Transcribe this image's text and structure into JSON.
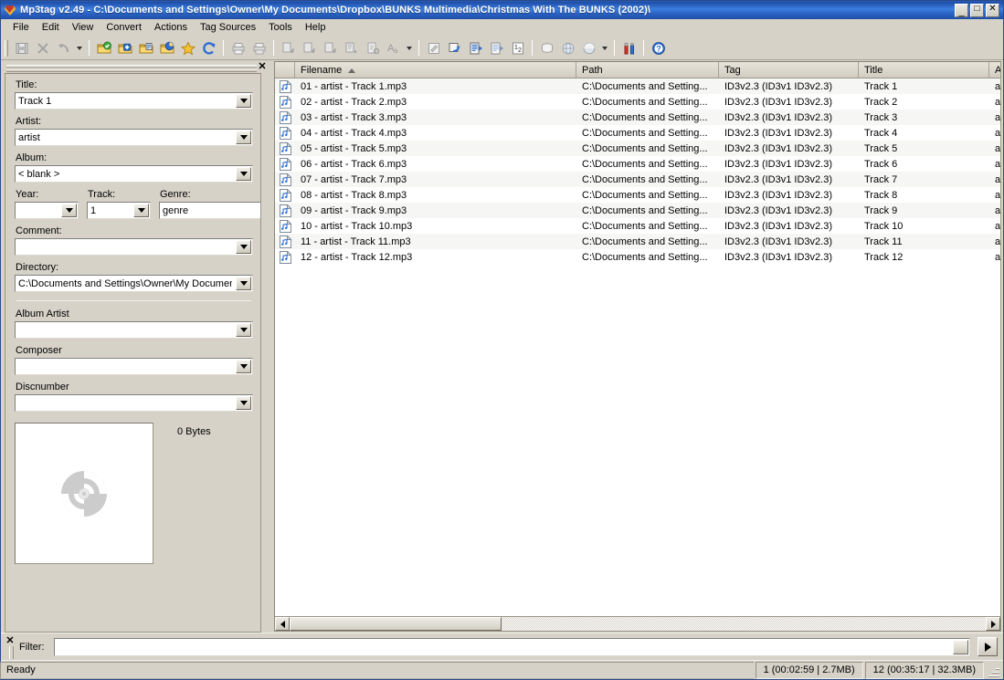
{
  "window": {
    "app_title": "Mp3tag v2.49",
    "separator": "-",
    "path": "C:\\Documents and Settings\\Owner\\My Documents\\Dropbox\\BUNKS Multimedia\\Christmas With The BUNKS (2002)\\",
    "full_title": "Mp3tag v2.49  -  C:\\Documents and Settings\\Owner\\My Documents\\Dropbox\\BUNKS Multimedia\\Christmas With The BUNKS (2002)\\",
    "minimize_label": "_",
    "maximize_label": "□",
    "close_label": "✕",
    "titlebar_color": "#2b63c4"
  },
  "menu": {
    "items": [
      {
        "label": "File"
      },
      {
        "label": "Edit"
      },
      {
        "label": "View"
      },
      {
        "label": "Convert"
      },
      {
        "label": "Actions"
      },
      {
        "label": "Tag Sources"
      },
      {
        "label": "Tools"
      },
      {
        "label": "Help"
      }
    ]
  },
  "toolbar": {
    "buttons": [
      {
        "name": "save-icon",
        "label": "Save",
        "enabled": false
      },
      {
        "name": "remove-tag-icon",
        "label": "Remove tag",
        "enabled": false
      },
      {
        "name": "undo-icon",
        "label": "Undo",
        "enabled": false
      },
      {
        "name": "undo-dropdown-icon",
        "label": "Undo history",
        "enabled": false
      },
      {
        "name": "change-directory-icon",
        "label": "Change directory",
        "enabled": true
      },
      {
        "name": "add-directory-icon",
        "label": "Add directory",
        "enabled": true
      },
      {
        "name": "add-files-icon",
        "label": "Add files",
        "enabled": true
      },
      {
        "name": "open-playlist-icon",
        "label": "Open playlist",
        "enabled": true
      },
      {
        "name": "favorites-icon",
        "label": "Favorites",
        "enabled": true
      },
      {
        "name": "refresh-icon",
        "label": "Refresh",
        "enabled": true
      },
      {
        "name": "print-icon",
        "label": "Print",
        "enabled": false
      },
      {
        "name": "print-cover-icon",
        "label": "Print cover",
        "enabled": false
      },
      {
        "name": "tag-to-filename-icon",
        "label": "Tag - Filename",
        "enabled": false
      },
      {
        "name": "filename-to-tag-icon",
        "label": "Filename - Tag",
        "enabled": false
      },
      {
        "name": "filename-to-filename-icon",
        "label": "Filename - Filename",
        "enabled": false
      },
      {
        "name": "tag-to-tag-icon",
        "label": "Tag - Tag",
        "enabled": false
      },
      {
        "name": "text-file-to-tag-icon",
        "label": "Text file - Tag",
        "enabled": false
      },
      {
        "name": "case-conversion-icon",
        "label": "Case conversion",
        "enabled": false
      },
      {
        "name": "convert-dropdown-icon",
        "label": "More conversions",
        "enabled": false
      },
      {
        "name": "edit-actions-icon",
        "label": "Actions",
        "enabled": false
      },
      {
        "name": "quick-actions-icon",
        "label": "Actions (quick)",
        "enabled": true
      },
      {
        "name": "create-playlist-icon",
        "label": "Create playlist",
        "enabled": true
      },
      {
        "name": "playlist-options-icon",
        "label": "Playlist options",
        "enabled": true
      },
      {
        "name": "auto-numbering-icon",
        "label": "Auto-numbering wizard",
        "enabled": true
      },
      {
        "name": "local-tag-source-icon",
        "label": "Tag sources (local)",
        "enabled": false
      },
      {
        "name": "web-tag-source-icon",
        "label": "Tag sources (web)",
        "enabled": false
      },
      {
        "name": "freedb-icon",
        "label": "freedb",
        "enabled": false
      },
      {
        "name": "tag-source-dropdown-icon",
        "label": "Tag source list",
        "enabled": false
      },
      {
        "name": "options-icon",
        "label": "Options",
        "enabled": true
      },
      {
        "name": "help-icon",
        "label": "Help",
        "enabled": true
      }
    ]
  },
  "tag_panel": {
    "close_label": "✕",
    "fields": [
      {
        "name": "title",
        "label": "Title:",
        "value": "Track 1",
        "placeholder": ""
      },
      {
        "name": "artist",
        "label": "Artist:",
        "value": "artist",
        "placeholder": ""
      },
      {
        "name": "album",
        "label": "Album:",
        "value": "< blank >",
        "placeholder": ""
      }
    ],
    "year": {
      "label": "Year:",
      "value": ""
    },
    "track": {
      "label": "Track:",
      "value": "1"
    },
    "genre": {
      "label": "Genre:",
      "value": "genre"
    },
    "comment": {
      "label": "Comment:",
      "value": ""
    },
    "directory": {
      "label": "Directory:",
      "value": "C:\\Documents and Settings\\Owner\\My Documents\\"
    },
    "extra_fields": [
      {
        "name": "albumartist",
        "label": "Album Artist",
        "value": ""
      },
      {
        "name": "composer",
        "label": "Composer",
        "value": ""
      },
      {
        "name": "discnumber",
        "label": "Discnumber",
        "value": ""
      }
    ],
    "cover": {
      "size_label": "0 Bytes",
      "placeholder_icon": "disc-icon"
    }
  },
  "file_list": {
    "columns": [
      {
        "key": "filename",
        "label": "Filename",
        "sorted": "asc"
      },
      {
        "key": "path",
        "label": "Path",
        "sorted": ""
      },
      {
        "key": "tag",
        "label": "Tag",
        "sorted": ""
      },
      {
        "key": "title",
        "label": "Title",
        "sorted": ""
      },
      {
        "key": "artist",
        "label": "A",
        "sorted": ""
      }
    ],
    "rows": [
      {
        "filename": "01 - artist - Track 1.mp3",
        "path": "C:\\Documents and Setting...",
        "tag": "ID3v2.3 (ID3v1 ID3v2.3)",
        "title": "Track 1",
        "artist": "ar"
      },
      {
        "filename": "02 - artist - Track 2.mp3",
        "path": "C:\\Documents and Setting...",
        "tag": "ID3v2.3 (ID3v1 ID3v2.3)",
        "title": "Track 2",
        "artist": "ar"
      },
      {
        "filename": "03 - artist - Track 3.mp3",
        "path": "C:\\Documents and Setting...",
        "tag": "ID3v2.3 (ID3v1 ID3v2.3)",
        "title": "Track 3",
        "artist": "ar"
      },
      {
        "filename": "04 - artist - Track 4.mp3",
        "path": "C:\\Documents and Setting...",
        "tag": "ID3v2.3 (ID3v1 ID3v2.3)",
        "title": "Track 4",
        "artist": "ar"
      },
      {
        "filename": "05 - artist - Track 5.mp3",
        "path": "C:\\Documents and Setting...",
        "tag": "ID3v2.3 (ID3v1 ID3v2.3)",
        "title": "Track 5",
        "artist": "ar"
      },
      {
        "filename": "06 - artist - Track 6.mp3",
        "path": "C:\\Documents and Setting...",
        "tag": "ID3v2.3 (ID3v1 ID3v2.3)",
        "title": "Track 6",
        "artist": "ar"
      },
      {
        "filename": "07 - artist - Track 7.mp3",
        "path": "C:\\Documents and Setting...",
        "tag": "ID3v2.3 (ID3v1 ID3v2.3)",
        "title": "Track 7",
        "artist": "ar"
      },
      {
        "filename": "08 - artist - Track 8.mp3",
        "path": "C:\\Documents and Setting...",
        "tag": "ID3v2.3 (ID3v1 ID3v2.3)",
        "title": "Track 8",
        "artist": "ar"
      },
      {
        "filename": "09 - artist - Track 9.mp3",
        "path": "C:\\Documents and Setting...",
        "tag": "ID3v2.3 (ID3v1 ID3v2.3)",
        "title": "Track 9",
        "artist": "ar"
      },
      {
        "filename": "10 - artist - Track 10.mp3",
        "path": "C:\\Documents and Setting...",
        "tag": "ID3v2.3 (ID3v1 ID3v2.3)",
        "title": "Track 10",
        "artist": "ar"
      },
      {
        "filename": "11 - artist - Track 11.mp3",
        "path": "C:\\Documents and Setting...",
        "tag": "ID3v2.3 (ID3v1 ID3v2.3)",
        "title": "Track 11",
        "artist": "ar"
      },
      {
        "filename": "12 - artist - Track 12.mp3",
        "path": "C:\\Documents and Setting...",
        "tag": "ID3v2.3 (ID3v1 ID3v2.3)",
        "title": "Track 12",
        "artist": "ar"
      }
    ]
  },
  "filter": {
    "close_label": "✕",
    "label": "Filter:",
    "value": "",
    "placeholder": "",
    "go_label": "▶"
  },
  "status_bar": {
    "message": "Ready",
    "selection": "1 (00:02:59 | 2.7MB)",
    "total": "12 (00:35:17 | 32.3MB)"
  }
}
